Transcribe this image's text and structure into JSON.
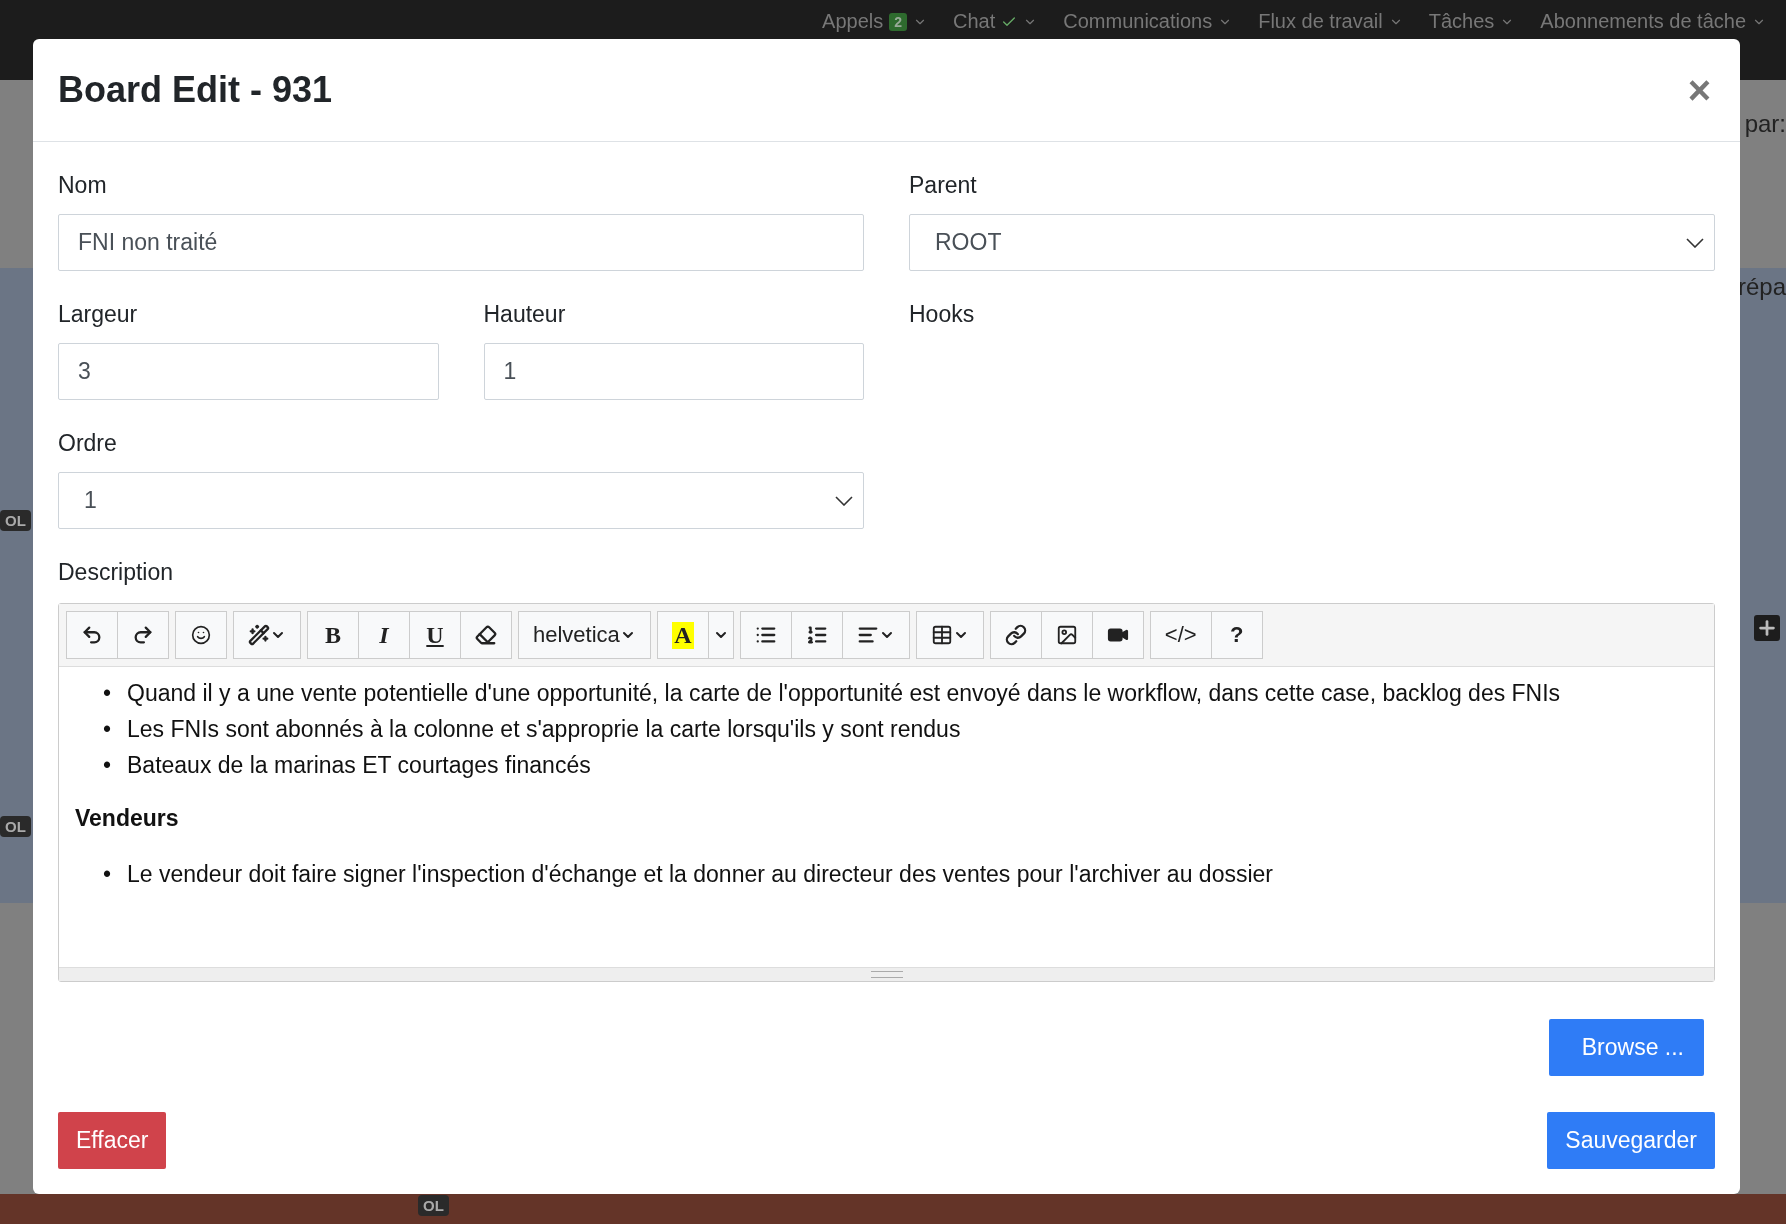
{
  "background": {
    "nav": [
      {
        "label": "Appels",
        "badge": "2"
      },
      {
        "label": "Chat",
        "check": true
      },
      {
        "label": "Communications"
      },
      {
        "label": "Flux de travail"
      },
      {
        "label": "Tâches"
      },
      {
        "label": "Abonnements de tâche"
      }
    ],
    "side_texts": [
      "par:",
      "répa"
    ],
    "badges": [
      "OL",
      "OL",
      "OL"
    ]
  },
  "modal": {
    "title": "Board Edit - 931",
    "close": "×",
    "fields": {
      "nom": {
        "label": "Nom",
        "value": "FNI non traité"
      },
      "parent": {
        "label": "Parent",
        "value": "ROOT"
      },
      "largeur": {
        "label": "Largeur",
        "value": "3"
      },
      "hauteur": {
        "label": "Hauteur",
        "value": "1"
      },
      "hooks": {
        "label": "Hooks"
      },
      "ordre": {
        "label": "Ordre",
        "value": "1"
      }
    },
    "description": {
      "label": "Description",
      "toolbar": [
        [
          {
            "kind": "undo"
          },
          {
            "kind": "redo"
          }
        ],
        [
          {
            "kind": "emoji"
          }
        ],
        [
          {
            "kind": "magic"
          }
        ],
        [
          {
            "kind": "bold",
            "label": "B"
          },
          {
            "kind": "italic",
            "label": "I"
          },
          {
            "kind": "underline",
            "label": "U"
          },
          {
            "kind": "eraser"
          }
        ],
        [
          {
            "kind": "font",
            "label": "helvetica"
          }
        ],
        [
          {
            "kind": "color",
            "label": "A"
          },
          {
            "kind": "caret"
          }
        ],
        [
          {
            "kind": "ul"
          },
          {
            "kind": "ol"
          },
          {
            "kind": "align"
          }
        ],
        [
          {
            "kind": "table"
          }
        ],
        [
          {
            "kind": "link"
          },
          {
            "kind": "image"
          },
          {
            "kind": "video"
          }
        ],
        [
          {
            "kind": "code",
            "label": "</>"
          },
          {
            "kind": "help",
            "label": "?"
          }
        ]
      ],
      "content": [
        {
          "kind": "list",
          "marker": "•",
          "items": [
            "Quand il y a une vente potentielle d'une opportunité, la carte de l'opportunité est envoyé dans le workflow, dans cette case, backlog des FNIs",
            "Les FNIs sont abonnés à la colonne et s'approprie la carte lorsqu'ils y sont rendus",
            "Bateaux de la marinas ET courtages financés"
          ]
        },
        {
          "kind": "heading",
          "text": "Vendeurs"
        },
        {
          "kind": "list",
          "marker": "•",
          "items": [
            "Le vendeur doit faire signer l'inspection d'échange et la donner au directeur des ventes pour l'archiver au dossier"
          ]
        }
      ]
    },
    "browse_button": "Browse ...",
    "delete_button": "Effacer",
    "save_button": "Sauvegarder"
  }
}
